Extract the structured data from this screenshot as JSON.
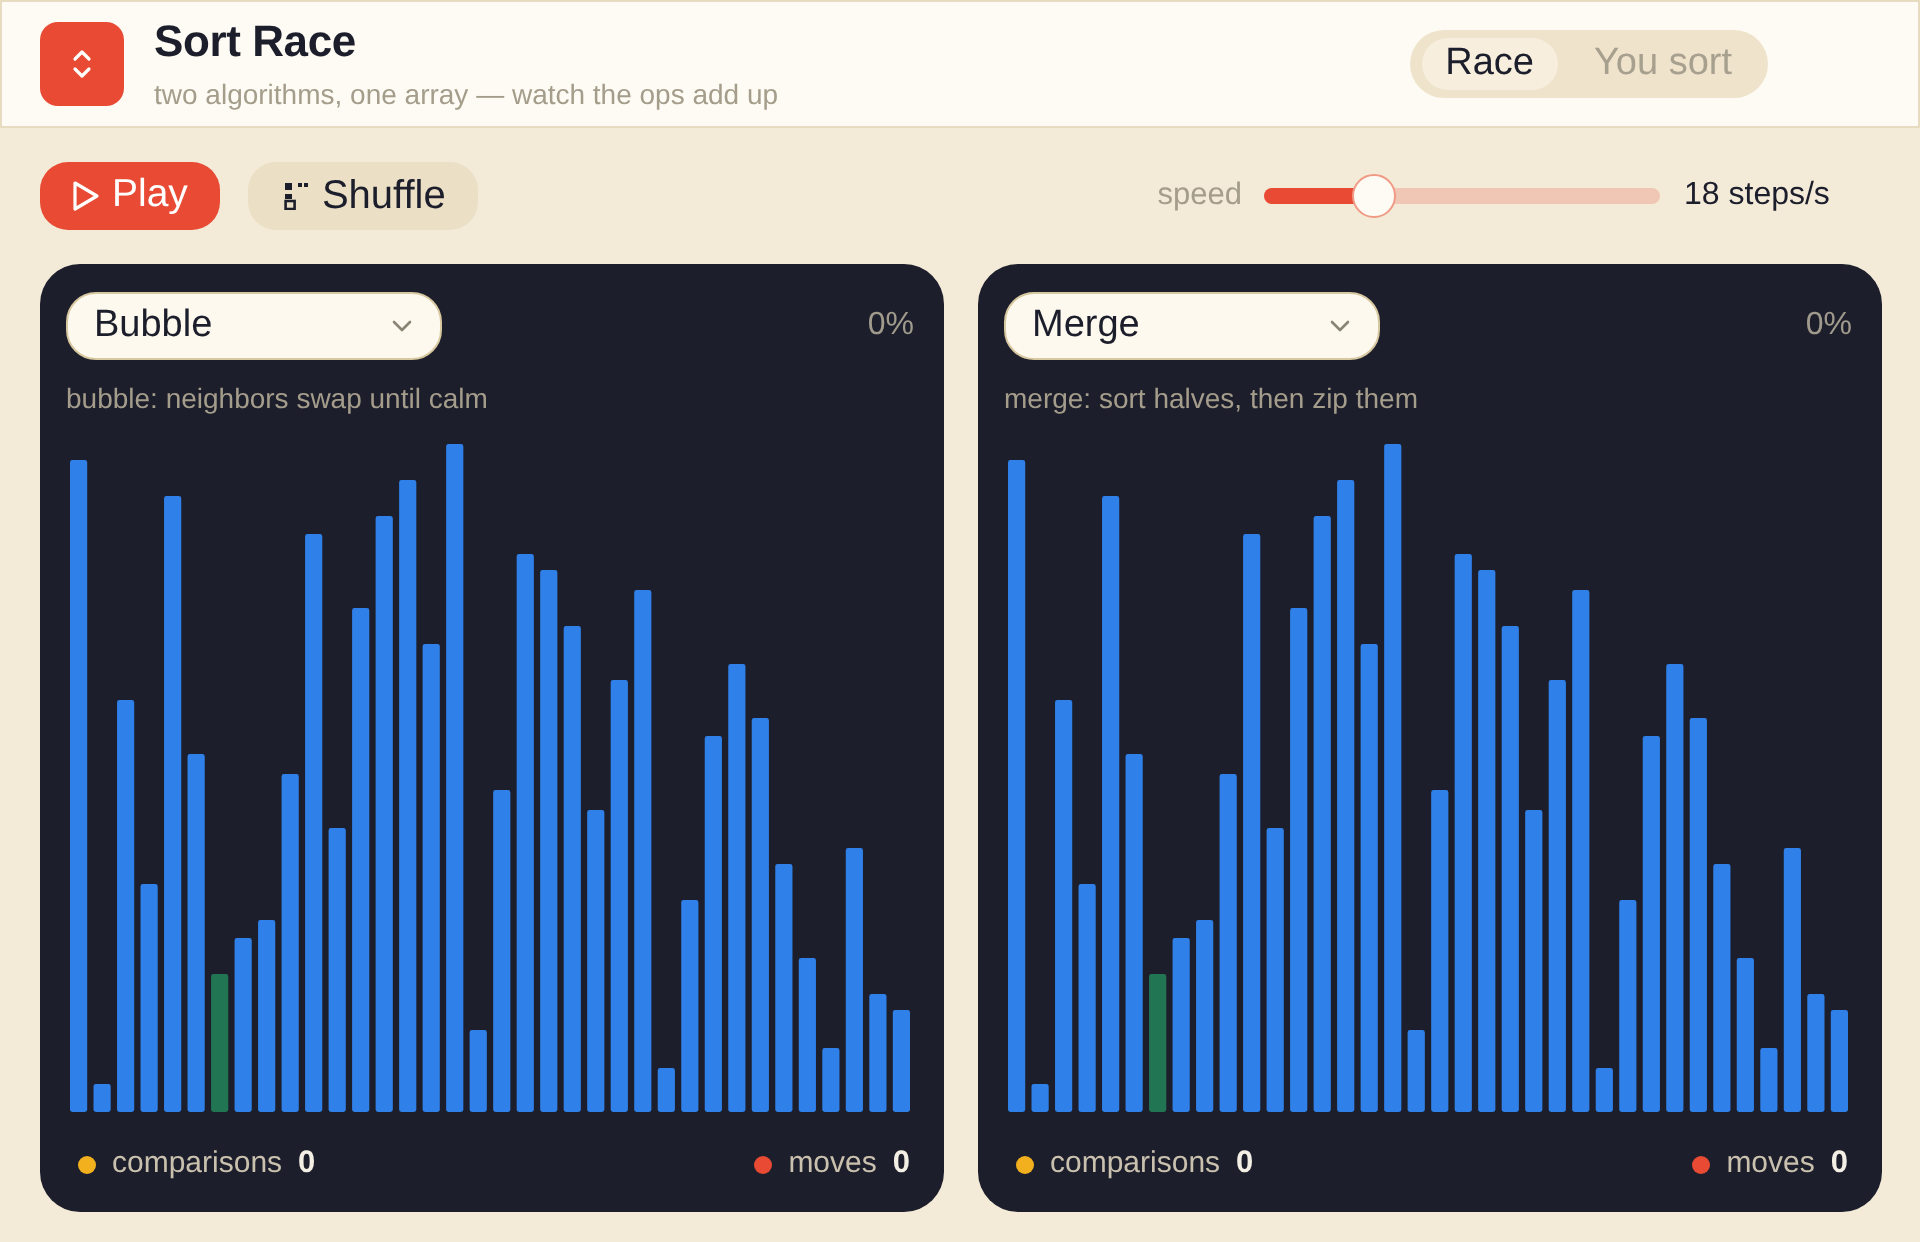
{
  "header": {
    "title": "Sort Race",
    "subtitle": "two algorithms, one array — watch the ops add up"
  },
  "mode_tabs": [
    {
      "label": "Race",
      "selected": true
    },
    {
      "label": "You sort",
      "selected": false
    }
  ],
  "toolbar": {
    "play_button": "Play",
    "shuffle_button": "Shuffle",
    "speed": {
      "label": "speed",
      "level": 0.28,
      "reading": "18 steps/s"
    }
  },
  "panels": [
    {
      "algorithm": "Bubble",
      "progress": "0%",
      "description": "bubble: neighbors swap until calm",
      "stats": [
        {
          "label": "comparisons",
          "value": "0",
          "color": "#f2b01e"
        },
        {
          "label": "moves",
          "value": "0",
          "color": "#e84a33"
        }
      ]
    },
    {
      "algorithm": "Merge",
      "progress": "0%",
      "description": "merge: sort halves, then zip them",
      "stats": [
        {
          "label": "comparisons",
          "value": "0",
          "color": "#f2b01e"
        },
        {
          "label": "moves",
          "value": "0",
          "color": "#e84a33"
        }
      ]
    }
  ]
}
